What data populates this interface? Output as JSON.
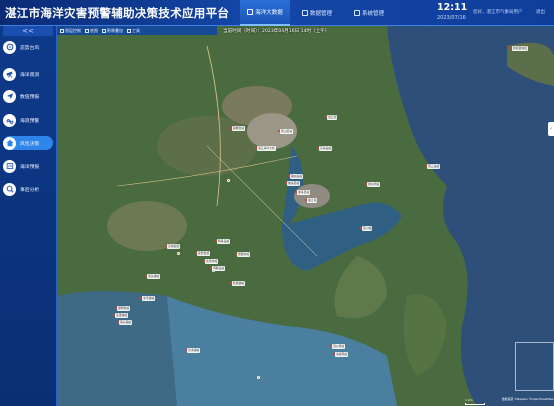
{
  "app": {
    "title": "湛江市海洋灾害预警辅助决策技术应用平台",
    "clock": "12:11",
    "date": "2023/07/16",
    "welcome": "您好，湛江市气象局用户",
    "logout": "退出"
  },
  "nav_tabs": [
    {
      "label": "海洋大数据",
      "active": true
    },
    {
      "label": "数据管理",
      "active": false
    },
    {
      "label": "系统管理",
      "active": false
    }
  ],
  "sidebar": {
    "collapse_label": "<<",
    "items": [
      {
        "label": "态势台风",
        "icon": "typhoon-icon",
        "active": false
      },
      {
        "label": "海洋观测",
        "icon": "telescope-icon",
        "active": false
      },
      {
        "label": "数值预报",
        "icon": "paper-plane-icon",
        "active": false
      },
      {
        "label": "海浪预警",
        "icon": "wave-icon",
        "active": false
      },
      {
        "label": "风险决策",
        "icon": "house-icon",
        "active": true
      },
      {
        "label": "海洋预报",
        "icon": "forecast-icon",
        "active": false
      },
      {
        "label": "事后分析",
        "icon": "analysis-icon",
        "active": false
      }
    ]
  },
  "map": {
    "toolbar": [
      "图层控制",
      "底图",
      "影像叠加",
      "工具"
    ],
    "time_label": "当前时间（时间）：2023年04月16日 14时（上午）",
    "scale": "1 km",
    "credit": "数据来源 ©Mapbox ©OpenStreetMap",
    "handle_label": "‹",
    "labels": [
      "徐闻县城区",
      "湛江港",
      "麻章区站",
      "霞山区站",
      "湛江海湾大桥",
      "东海岛站",
      "南三岛站",
      "硇洲岛站",
      "坡头区站",
      "雷州湾站",
      "遂溪县站",
      "廉江站",
      "吴川站",
      "特呈岛站",
      "东简街道",
      "民安街道",
      "觉民村站",
      "北月村站",
      "调顺岛站",
      "龙头镇站",
      "乾塘镇站",
      "太平镇站",
      "通明港站",
      "东里镇站",
      "南兴镇站",
      "企水镇站",
      "流沙港站",
      "海康港站"
    ]
  },
  "colors": {
    "header_bg": "#1447a8",
    "sidebar_bg": "#0d3a8a",
    "accent": "#2f86ea",
    "sea": "#2d4f7a",
    "land": "#4a6b3f"
  }
}
